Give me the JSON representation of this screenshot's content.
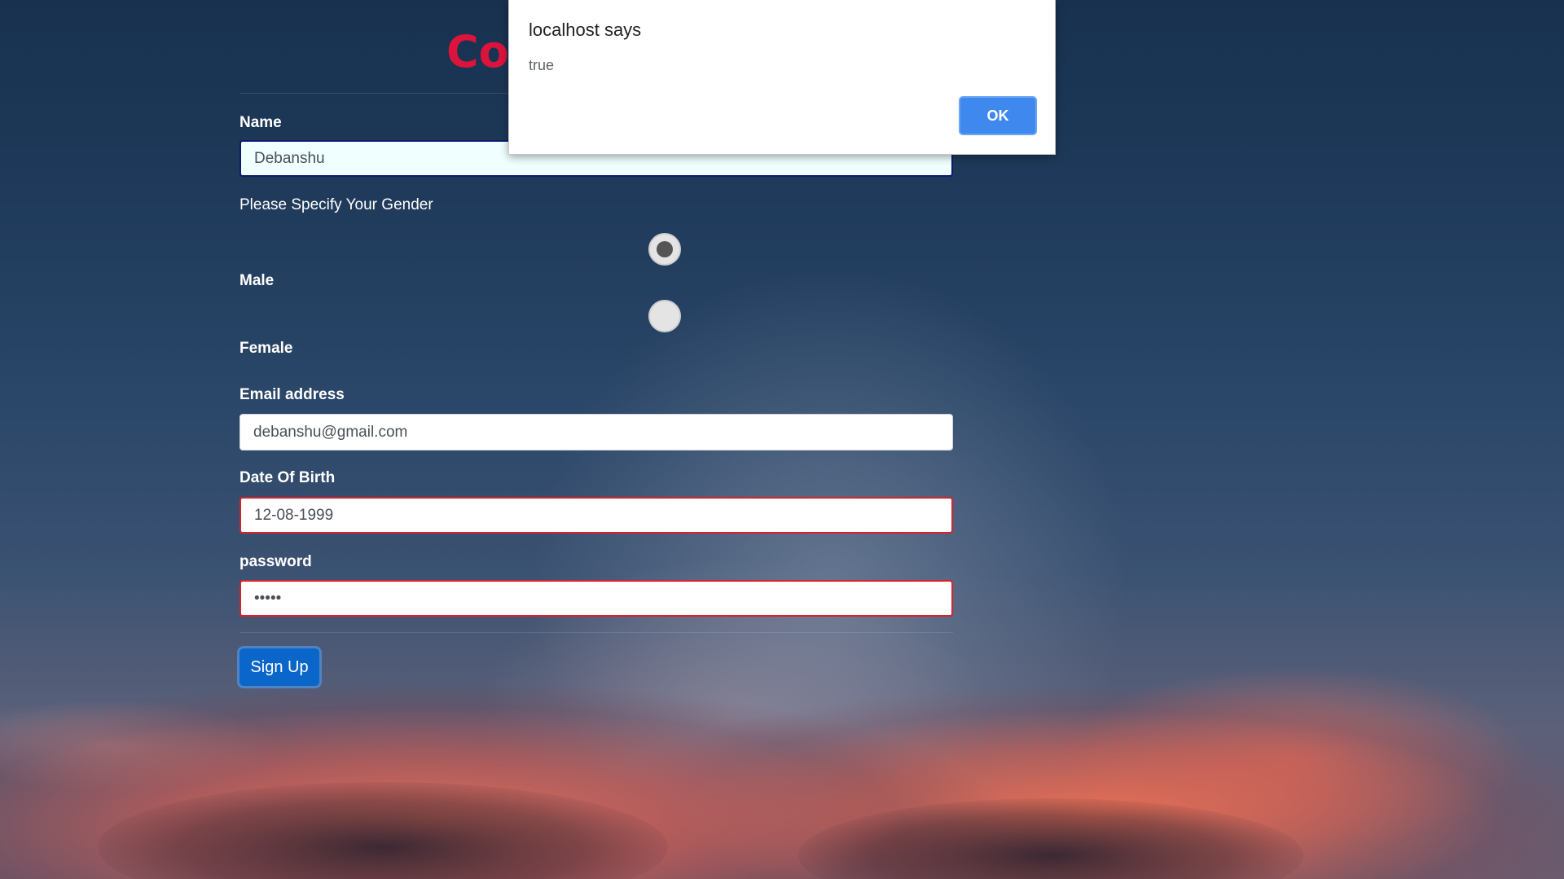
{
  "page": {
    "title": "Co"
  },
  "form": {
    "name_label": "Name",
    "name_value": "Debanshu",
    "gender_prompt": "Please Specify Your Gender",
    "gender_options": [
      {
        "label": "Male",
        "selected": true
      },
      {
        "label": "Female",
        "selected": false
      }
    ],
    "email_label": "Email address",
    "email_value": "debanshu@gmail.com",
    "dob_label": "Date Of Birth",
    "dob_value": "12-08-1999",
    "password_label": "password",
    "password_value": "•••••",
    "submit_label": "Sign Up"
  },
  "dialog": {
    "title": "localhost says",
    "message": "true",
    "ok_label": "OK"
  },
  "colors": {
    "title_accent": "#dc143c",
    "invalid_border": "#d9232b",
    "primary_button": "#0a66c9",
    "dialog_ok": "#3f88ee"
  }
}
